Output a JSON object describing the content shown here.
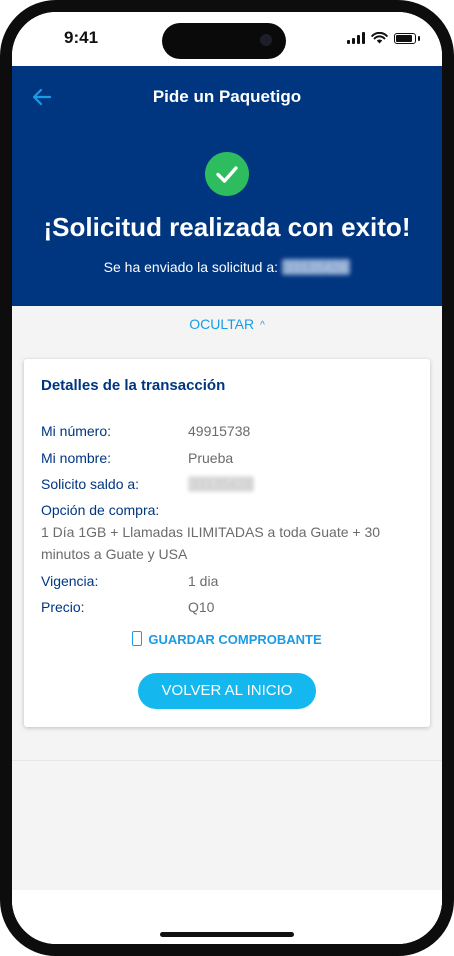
{
  "status_bar": {
    "time": "9:41"
  },
  "app_bar": {
    "title": "Pide un Paquetigo",
    "back_icon": "arrow-left-icon"
  },
  "hero": {
    "icon": "check-circle-icon",
    "title": "¡Solicitud realizada con exito!",
    "subtitle": "Se ha enviado la solicitud a:",
    "recipient_number": "33135428"
  },
  "toggle": {
    "label": "OCULTAR",
    "icon": "chevron-up-icon"
  },
  "details": {
    "title": "Detalles de la transacción",
    "my_number_label": "Mi número:",
    "my_number_value": "49915738",
    "my_name_label": "Mi nombre:",
    "my_name_value": "Prueba",
    "request_label": "Solicito saldo a:",
    "request_value": "33135428",
    "option_label": "Opción de compra:",
    "option_value": "1 Día 1GB + Llamadas ILIMITADAS a toda Guate + 30 minutos a Guate y USA",
    "validity_label": "Vigencia:",
    "validity_value": "1 dia",
    "price_label": "Precio:",
    "price_value": "Q10",
    "save_label": "GUARDAR COMPROBANTE",
    "save_icon": "phone-icon",
    "home_label": "VOLVER AL INICIO"
  },
  "colors": {
    "primary": "#003580",
    "accent": "#14b8ef",
    "link": "#1a9be6",
    "success": "#2ebd5e"
  }
}
